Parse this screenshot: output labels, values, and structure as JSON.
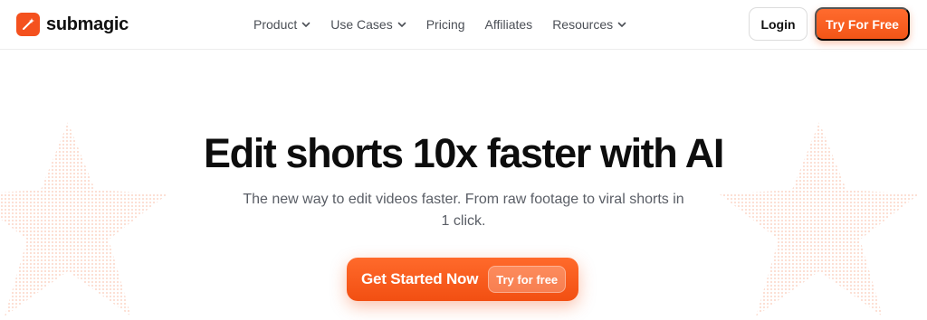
{
  "brand": {
    "name": "submagic",
    "accent": "#f4511e"
  },
  "nav": {
    "items": [
      {
        "label": "Product",
        "has_dropdown": true
      },
      {
        "label": "Use Cases",
        "has_dropdown": true
      },
      {
        "label": "Pricing",
        "has_dropdown": false
      },
      {
        "label": "Affiliates",
        "has_dropdown": false
      },
      {
        "label": "Resources",
        "has_dropdown": true
      }
    ],
    "login_label": "Login",
    "try_label": "Try For Free"
  },
  "hero": {
    "title": "Edit shorts 10x faster with AI",
    "subtitle": "The new way to edit videos faster. From raw footage to viral shorts in 1 click.",
    "cta_label": "Get Started Now",
    "cta_badge": "Try for free"
  },
  "colors": {
    "primary": "#f25517",
    "text": "#0d0d0d",
    "muted": "#5a5e66"
  },
  "icons": {
    "logo": "magic-wand-icon",
    "dropdown": "chevron-down-icon",
    "decoration": "star-icon"
  }
}
